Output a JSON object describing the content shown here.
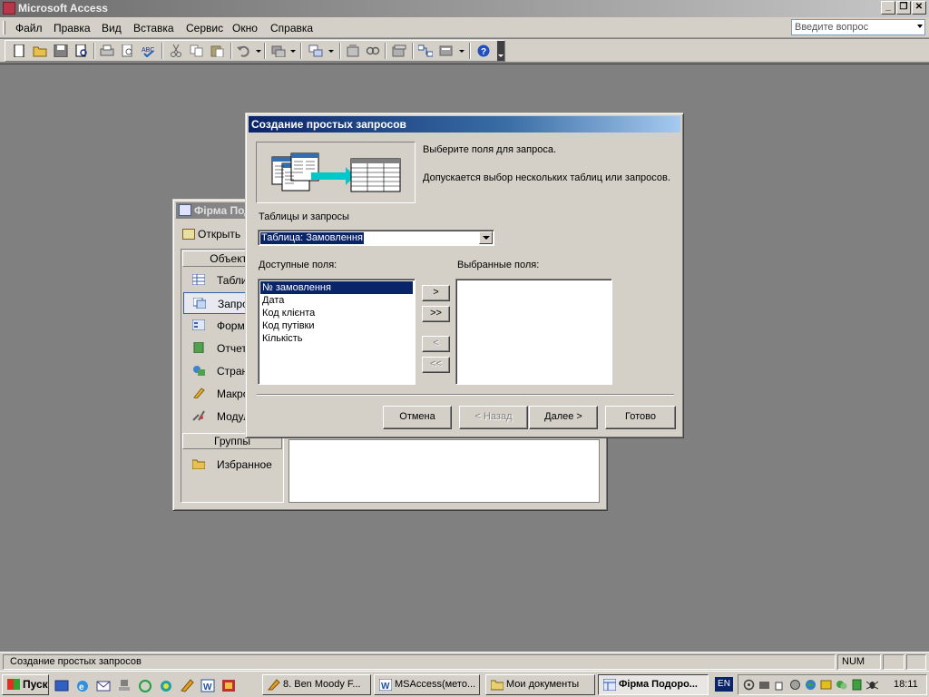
{
  "app": {
    "title": "Microsoft Access"
  },
  "menubar": {
    "items": [
      "Файл",
      "Правка",
      "Вид",
      "Вставка",
      "Сервис",
      "Окно",
      "Справка"
    ],
    "ask_placeholder": "Введите вопрос"
  },
  "toolbar": {
    "icons": [
      "new-icon",
      "open-icon",
      "save-icon",
      "search-icon",
      "print-icon",
      "print-preview-icon",
      "spelling-icon",
      "cut-icon",
      "copy-icon",
      "paste-icon",
      "undo-icon",
      "office-links-icon",
      "analyze-icon",
      "code-icon",
      "properties-icon",
      "relationships-icon",
      "new-object-icon",
      "help-icon"
    ]
  },
  "db_window": {
    "title": "Фірма Подорожі",
    "open_label": "Открыть",
    "objects_header": "Объекты",
    "objects": [
      {
        "label": "Таблицы",
        "icon": "table-icon"
      },
      {
        "label": "Запросы",
        "icon": "query-icon"
      },
      {
        "label": "Формы",
        "icon": "form-icon"
      },
      {
        "label": "Отчеты",
        "icon": "report-icon"
      },
      {
        "label": "Страницы",
        "icon": "page-icon"
      },
      {
        "label": "Макросы",
        "icon": "macro-icon"
      },
      {
        "label": "Модули",
        "icon": "module-icon"
      }
    ],
    "groups_header": "Группы",
    "favorites": "Избранное"
  },
  "wizard": {
    "title": "Создание простых запросов",
    "instruction": "Выберите поля для запроса.",
    "hint": "Допускается выбор нескольких таблиц или запросов.",
    "tables_label": "Таблицы и запросы",
    "selected_table": "Таблица: Замовлення",
    "available_label": "Доступные поля:",
    "selected_label": "Выбранные поля:",
    "available_fields": [
      "№ замовлення",
      "Дата",
      "Код клієнта",
      "Код путівки",
      "Кількість"
    ],
    "selected_index": 0,
    "move_buttons": {
      "add_one": ">",
      "add_all": ">>",
      "remove_one": "<",
      "remove_all": "<<"
    },
    "buttons": {
      "cancel": "Отмена",
      "back": "< Назад",
      "next": "Далее >",
      "finish": "Готово"
    }
  },
  "statusbar": {
    "text": "Создание простых запросов",
    "num": "NUM"
  },
  "taskbar": {
    "start": "Пуск",
    "tasks": [
      {
        "label": "8. Ben Moody F...",
        "icon": "winamp-icon"
      },
      {
        "label": "MSAccess(мето...",
        "icon": "word-icon"
      },
      {
        "label": "Мои документы",
        "icon": "folder-icon"
      },
      {
        "label": "Фірма Подоро...",
        "icon": "access-db-icon"
      }
    ],
    "lang": "EN",
    "clock": "18:11"
  },
  "colors": {
    "title_active": "#0a246a",
    "title_inactive": "#808080",
    "face": "#d4d0c8",
    "desktop": "#808080"
  }
}
